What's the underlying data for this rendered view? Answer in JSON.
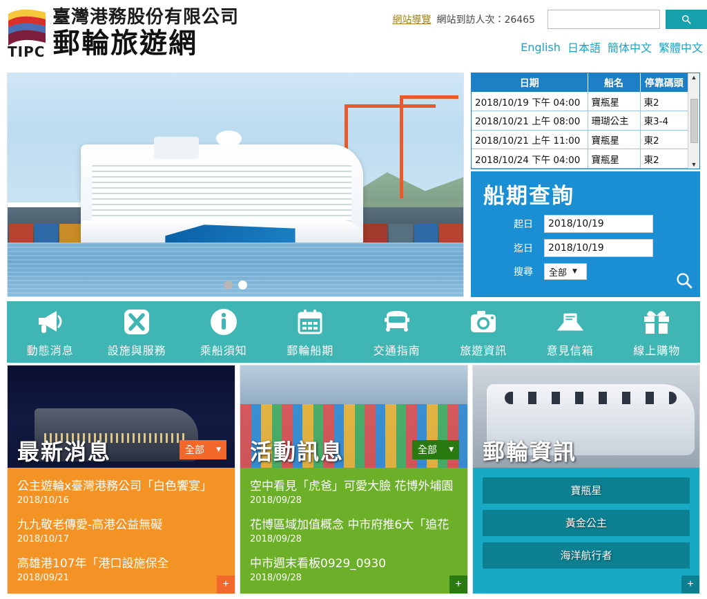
{
  "header": {
    "org_name": "臺灣港務股份有限公司",
    "site_name": "郵輪旅遊網",
    "logo_mark": "TIPC",
    "sitemap_label": "網站導覽",
    "visit_count_label": "網站到訪人次：26465",
    "search_placeholder": "",
    "search_value": "",
    "search_icon": "search-icon",
    "languages": [
      "English",
      "日本語",
      "簡体中文",
      "繁體中文"
    ],
    "accent_teal": "#16a0ac",
    "link_blue": "#1aa3c4",
    "sitemap_gold": "#a08218"
  },
  "carousel": {
    "slide_count": 2,
    "active_index": 1,
    "alt": "郵輪停靠碼頭照片"
  },
  "schedule_table": {
    "columns": [
      "日期",
      "船名",
      "停靠碼頭"
    ],
    "rows": [
      [
        "2018/10/19 下午 04:00",
        "寶瓶星",
        "東2"
      ],
      [
        "2018/10/21 上午 08:00",
        "珊瑚公主",
        "東3-4"
      ],
      [
        "2018/10/21 上午 11:00",
        "寶瓶星",
        "東2"
      ],
      [
        "2018/10/24 下午 04:00",
        "寶瓶星",
        "東2"
      ]
    ],
    "header_bg": "#1f7fc4",
    "scroll_up_icon": "chevron-up-icon",
    "scroll_down_icon": "chevron-down-icon"
  },
  "query": {
    "title": "船期查詢",
    "start_label": "起日",
    "start_value": "2018/10/19",
    "end_label": "迄日",
    "end_value": "2018/10/19",
    "search_label": "搜尋",
    "search_selected": "全部",
    "search_options": [
      "全部"
    ],
    "submit_icon": "search-icon",
    "bg": "#1b8fd4"
  },
  "nav": {
    "bg": "#3fb6b4",
    "items": [
      {
        "label": "動態消息",
        "icon": "megaphone-icon"
      },
      {
        "label": "設施與服務",
        "icon": "facilities-x-icon"
      },
      {
        "label": "乘船須知",
        "icon": "info-circle-icon"
      },
      {
        "label": "郵輪船期",
        "icon": "calendar-icon"
      },
      {
        "label": "交通指南",
        "icon": "bus-icon"
      },
      {
        "label": "旅遊資訊",
        "icon": "camera-icon"
      },
      {
        "label": "意見信箱",
        "icon": "envelope-message-icon"
      },
      {
        "label": "線上購物",
        "icon": "gift-icon"
      }
    ]
  },
  "panels": [
    {
      "key": "latest_news",
      "title": "最新消息",
      "filter_label": "全部",
      "filter_icon": "caret-down-icon",
      "body_bg": "#f39325",
      "filter_bg": "#f2672a",
      "plus_bg": "#f2672a",
      "plus_label": "+",
      "photo": "night-cruise-photo",
      "items": [
        {
          "title": "公主遊輪x臺灣港務公司「白色饗宴」",
          "date": "2018/10/16"
        },
        {
          "title": "九九敬老傳愛-高港公益無礙",
          "date": "2018/10/17"
        },
        {
          "title": "高雄港107年「港口設施保全",
          "date": "2018/09/21"
        }
      ]
    },
    {
      "key": "event_news",
      "title": "活動訊息",
      "filter_label": "全部",
      "filter_icon": "caret-down-icon",
      "body_bg": "#6cb02a",
      "filter_bg": "#2a7a12",
      "plus_bg": "#2a7a12",
      "plus_label": "+",
      "photo": "festival-photo",
      "items": [
        {
          "title": "空中看見「虎爸」可愛大臉 花博外埔園",
          "date": "2018/09/28"
        },
        {
          "title": "花博區域加值概念 中市府推6大「追花",
          "date": "2018/09/28"
        },
        {
          "title": "中市週末看板0929_0930",
          "date": "2018/09/28"
        }
      ]
    },
    {
      "key": "cruise_info",
      "title": "郵輪資訊",
      "body_bg": "#18a9c4",
      "plus_bg": "#0c7f91",
      "plus_label": "+",
      "photo": "white-cruise-photo",
      "buttons": [
        "寶瓶星",
        "黃金公主",
        "海洋航行者"
      ]
    }
  ]
}
